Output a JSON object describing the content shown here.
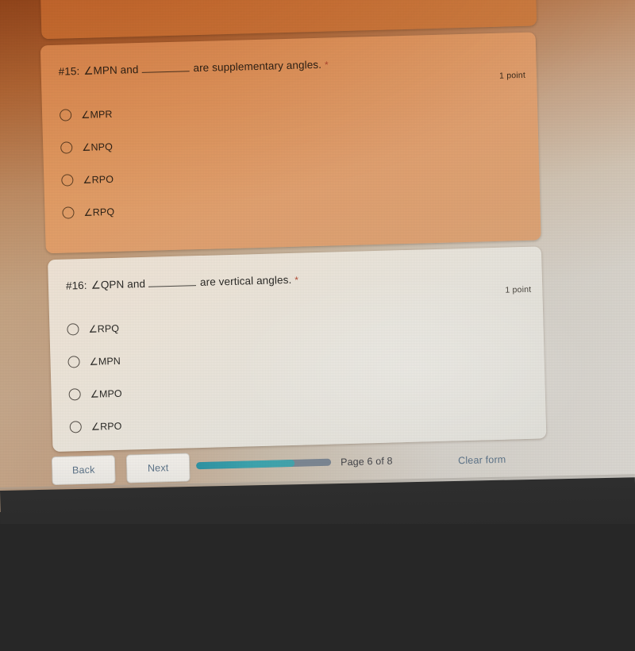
{
  "form": {
    "top_partial_card": {
      "present": true
    },
    "questions": [
      {
        "id": "q15",
        "number_prefix": "#15:",
        "stem_before_blank": "∠MPN and",
        "stem_after_blank": "are supplementary angles.",
        "required_marker": "*",
        "points": "1 point",
        "options": [
          {
            "label": "∠MPR",
            "selected": false
          },
          {
            "label": "∠NPQ",
            "selected": false
          },
          {
            "label": "∠RPO",
            "selected": false
          },
          {
            "label": "∠RPQ",
            "selected": false
          }
        ]
      },
      {
        "id": "q16",
        "number_prefix": "#16:",
        "stem_before_blank": "∠QPN and",
        "stem_after_blank": "are vertical angles.",
        "required_marker": "*",
        "points": "1 point",
        "options": [
          {
            "label": "∠RPQ",
            "selected": false
          },
          {
            "label": "∠MPN",
            "selected": false
          },
          {
            "label": "∠MPO",
            "selected": false
          },
          {
            "label": "∠RPO",
            "selected": false
          }
        ]
      }
    ]
  },
  "navigation": {
    "back_label": "Back",
    "next_label": "Next",
    "page_indicator": "Page 6 of 8",
    "clear_form_label": "Clear form",
    "progress_percent": 73
  },
  "colors": {
    "progress_fill": "#3c9aa8",
    "progress_track": "#7d8894",
    "link_text": "#5d7489",
    "required_star": "#b24a33",
    "card_q15_bg": "#e29559",
    "card_q16_bg": "#eee6da",
    "bezel": "#2b2b2b"
  }
}
